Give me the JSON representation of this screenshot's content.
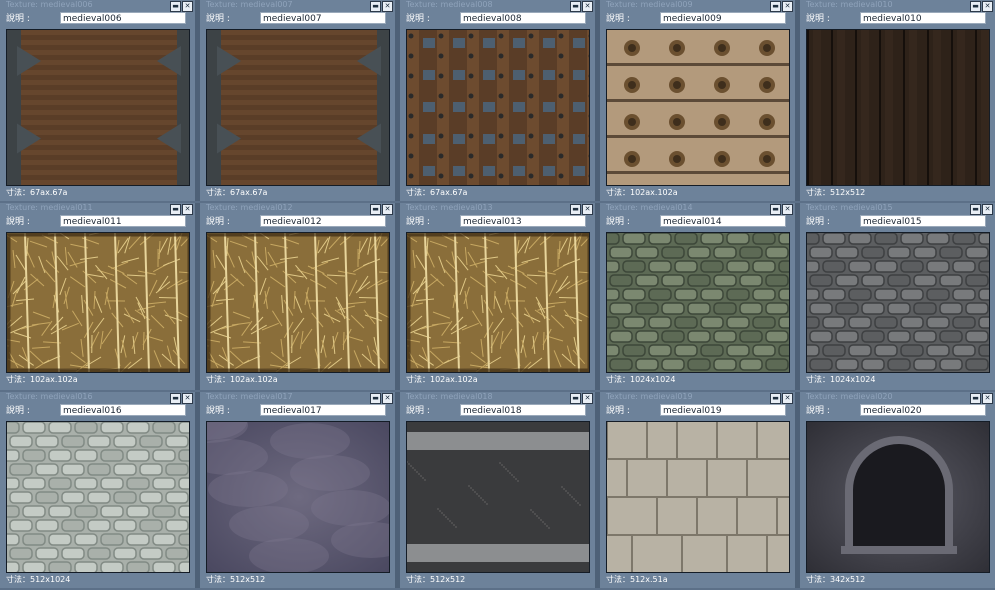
{
  "window_buttons": {
    "minimize": "minimize-button",
    "close": "close-button"
  },
  "desc_label": "說明 :",
  "size_prefix": "寸法：",
  "tiles": [
    {
      "title": "Texture: medieval006",
      "name": "medieval006",
      "size": "67ax.67a",
      "texture": "door-iron"
    },
    {
      "title": "Texture: medieval007",
      "name": "medieval007",
      "size": "67ax.67a",
      "texture": "door-iron2"
    },
    {
      "title": "Texture: medieval008",
      "name": "medieval008",
      "size": "67ax.67a",
      "texture": "door-studs"
    },
    {
      "title": "Texture: medieval009",
      "name": "medieval009",
      "size": "102ax.102a",
      "texture": "plank-rivets"
    },
    {
      "title": "Texture: medieval010",
      "name": "medieval010",
      "size": "512x512",
      "texture": "dark-wood"
    },
    {
      "title": "Texture: medieval011",
      "name": "medieval011",
      "size": "102ax.102a",
      "texture": "straw"
    },
    {
      "title": "Texture: medieval012",
      "name": "medieval012",
      "size": "102ax.102a",
      "texture": "straw"
    },
    {
      "title": "Texture: medieval013",
      "name": "medieval013",
      "size": "102ax.102a",
      "texture": "straw"
    },
    {
      "title": "Texture: medieval014",
      "name": "medieval014",
      "size": "1024x1024",
      "texture": "stone-green"
    },
    {
      "title": "Texture: medieval015",
      "name": "medieval015",
      "size": "1024x1024",
      "texture": "stone-grey"
    },
    {
      "title": "Texture: medieval016",
      "name": "medieval016",
      "size": "512x1024",
      "texture": "stone-light"
    },
    {
      "title": "Texture: medieval017",
      "name": "medieval017",
      "size": "512x512",
      "texture": "fog"
    },
    {
      "title": "Texture: medieval018",
      "name": "medieval018",
      "size": "512x512",
      "texture": "metal-bands"
    },
    {
      "title": "Texture: medieval019",
      "name": "medieval019",
      "size": "512x.51a",
      "texture": "stone-blocks"
    },
    {
      "title": "Texture: medieval020",
      "name": "medieval020",
      "size": "342x512",
      "texture": "arch-window"
    }
  ]
}
